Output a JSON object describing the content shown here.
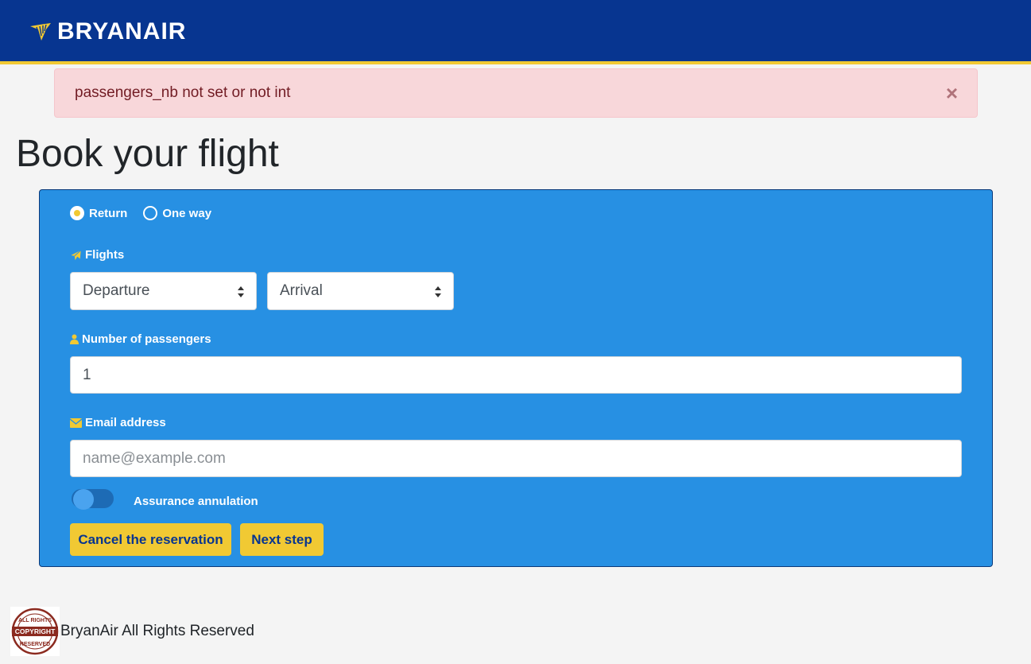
{
  "header": {
    "brand": "BRYANAIR",
    "logo_icon": "harp-icon",
    "bg_color": "#073590",
    "accent_color": "#f1c933"
  },
  "alert": {
    "message": "passengers_nb not set or not int",
    "close_label": "×"
  },
  "page_title": "Book your flight",
  "form": {
    "trip_type": {
      "options": [
        "Return",
        "One way"
      ],
      "selected": "Return"
    },
    "flights": {
      "label": "Flights",
      "icon": "paper-plane-icon",
      "departure": "Departure",
      "arrival": "Arrival"
    },
    "passengers": {
      "label": "Number of passengers",
      "icon": "user-icon",
      "value": "1"
    },
    "email": {
      "label": "Email address",
      "icon": "envelope-icon",
      "placeholder": "name@example.com",
      "value": ""
    },
    "insurance": {
      "label": "Assurance annulation",
      "enabled": false
    },
    "buttons": {
      "cancel": "Cancel the reservation",
      "next": "Next step"
    },
    "bg_color": "#2790e3"
  },
  "footer": {
    "seal_text_top": "ALL RIGHTS",
    "seal_text_mid": "COPYRIGHT",
    "seal_text_bottom": "RESERVED",
    "text": "BryanAir All Rights Reserved"
  }
}
